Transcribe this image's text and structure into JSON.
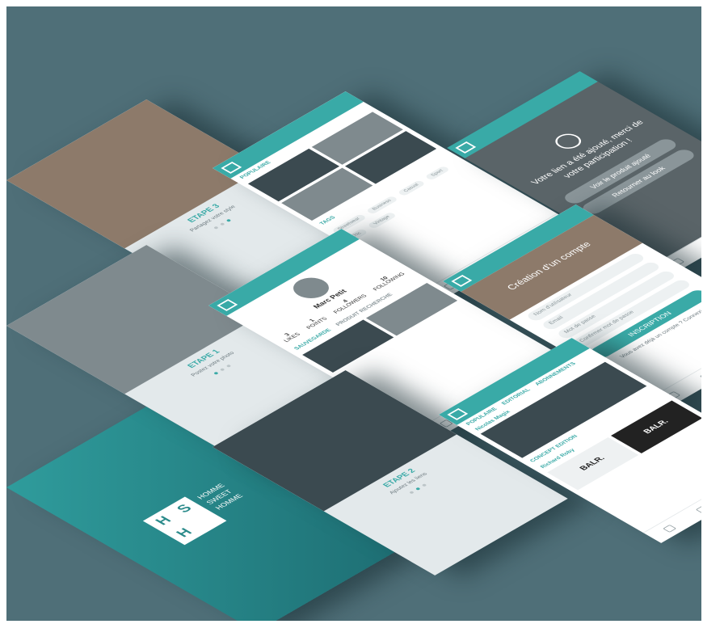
{
  "splash": {
    "initial_h": "H",
    "initial_s": "S",
    "initial_h2": "H",
    "line1": "HOMME",
    "line2": "SWEET",
    "line3": "HOMME"
  },
  "onboarding": [
    {
      "step": "ETAPE 1",
      "text": "Postez votre photo"
    },
    {
      "step": "ETAPE 2",
      "text": "Ajoutez les liens"
    },
    {
      "step": "ETAPE 3",
      "text": "Partagez votre style"
    }
  ],
  "explore": {
    "section_popular": "POPULAIRE",
    "section_tags": "TAGS",
    "tags": [
      "Streetwear",
      "Business",
      "Casual",
      "Sport",
      "Chic",
      "Vintage"
    ]
  },
  "profile": {
    "name": "Marc Petit",
    "stats": [
      {
        "value": "3",
        "label": "LIKES"
      },
      {
        "value": "1",
        "label": "POINTS"
      },
      {
        "value": "4",
        "label": "FOLLOWERS"
      },
      {
        "value": "10",
        "label": "FOLLOWING"
      }
    ],
    "tab1": "SAUVEGARDE",
    "tab2": "PRODUIT RECHERCHE"
  },
  "confirm": {
    "message": "Votre lien a été ajouté, merci de votre participation !",
    "btn1": "Voir le produit ajouté",
    "btn2": "Retourner au look"
  },
  "signup": {
    "title": "Création d'un compte",
    "fields": [
      "Nom d'utilisateur",
      "Email",
      "Mot de passe",
      "Confirmer mot de passe"
    ],
    "submit": "INSCRIPTION",
    "login": "Vous avez déjà un compte ? Connexion"
  },
  "feed": {
    "tabs": [
      "POPULAIRE",
      "EDITORIAL",
      "ABONNEMENTS"
    ],
    "user1": "Nicolas Magix",
    "user2": "Richard Roby",
    "label": "CONCEPT EDITION",
    "brand": "BALR."
  }
}
